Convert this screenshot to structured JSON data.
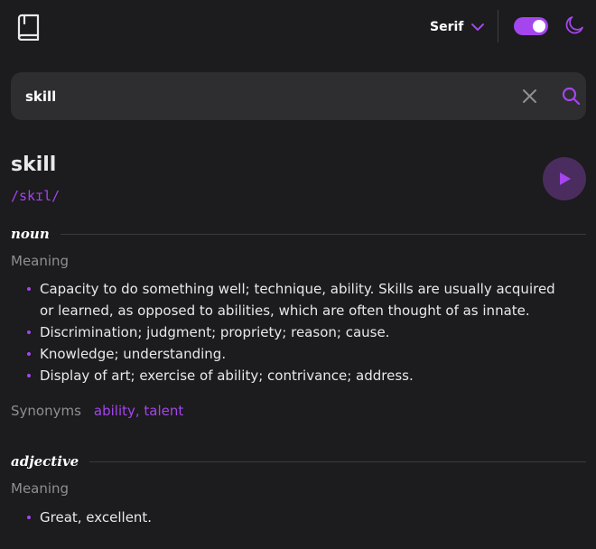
{
  "header": {
    "font_selected": "Serif",
    "theme_toggle_on": true
  },
  "search": {
    "value": "skill",
    "placeholder": ""
  },
  "entry": {
    "word": "skill",
    "phonetic": "/skɪl/"
  },
  "meanings": [
    {
      "part_of_speech": "noun",
      "meaning_label": "Meaning",
      "definitions": [
        "Capacity to do something well; technique, ability. Skills are usually acquired or learned, as opposed to abilities, which are often thought of as innate.",
        "Discrimination; judgment; propriety; reason; cause.",
        "Knowledge; understanding.",
        "Display of art; exercise of ability; contrivance; address."
      ],
      "synonyms_label": "Synonyms",
      "synonyms": "ability, talent"
    },
    {
      "part_of_speech": "adjective",
      "meaning_label": "Meaning",
      "definitions": [
        "Great, excellent."
      ]
    }
  ],
  "colors": {
    "accent": "#a445ed",
    "background": "#1c1b1d",
    "surface": "#2e2e30",
    "muted": "#8f8f8f"
  },
  "icons": {
    "logo": "book-icon",
    "font_chevron": "chevron-down-icon",
    "theme": "moon-icon",
    "clear": "close-icon",
    "search": "search-icon",
    "play": "play-icon"
  }
}
